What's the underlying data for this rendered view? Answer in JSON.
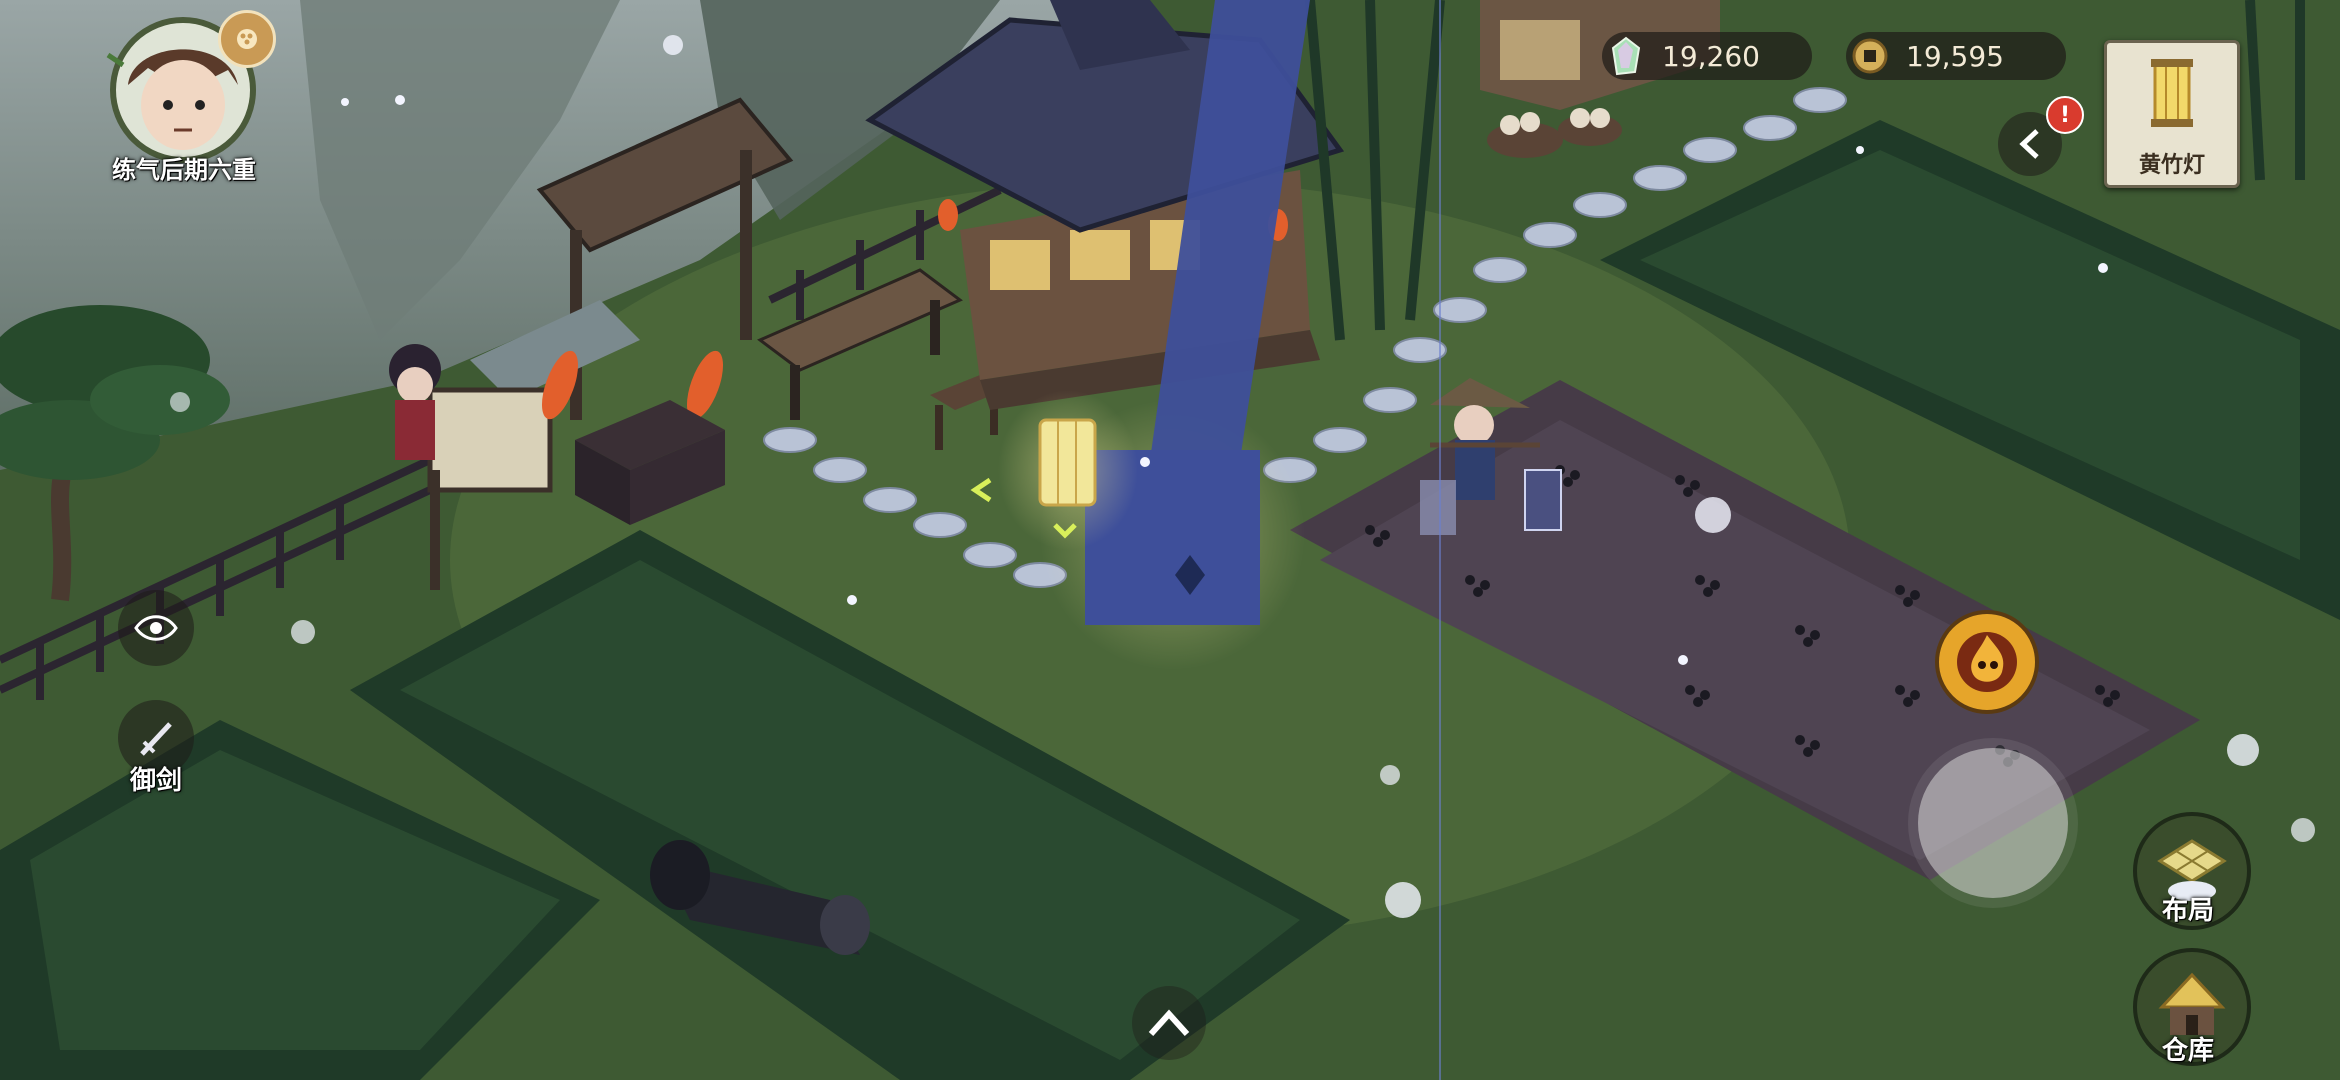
{
  "player": {
    "realm": "练气后期六重"
  },
  "currency": {
    "spirit_stones": "19,260",
    "coins": "19,595"
  },
  "item_card": {
    "label": "黄竹灯"
  },
  "left_buttons": {
    "fly_sword_label": "御剑"
  },
  "right_buttons": {
    "layout_label": "布局",
    "warehouse_label": "仓库"
  },
  "colors": {
    "grass": "#3e5a33",
    "soil": "#4a3f4a",
    "crop": "#1f3a28",
    "path_stone": "#b9c3d6",
    "house_roof": "#3a3f5e",
    "lantern": "#f2d37a",
    "notify_red": "#d93b2e"
  },
  "icons": [
    "avatar-portrait",
    "coin-badge",
    "spirit-stone-icon",
    "copper-coin-icon",
    "back-arrow-icon",
    "alert-icon",
    "lantern-icon",
    "eye-icon",
    "sword-icon",
    "chevron-up-icon",
    "fire-skill-icon",
    "joystick",
    "layout-icon",
    "warehouse-icon"
  ]
}
